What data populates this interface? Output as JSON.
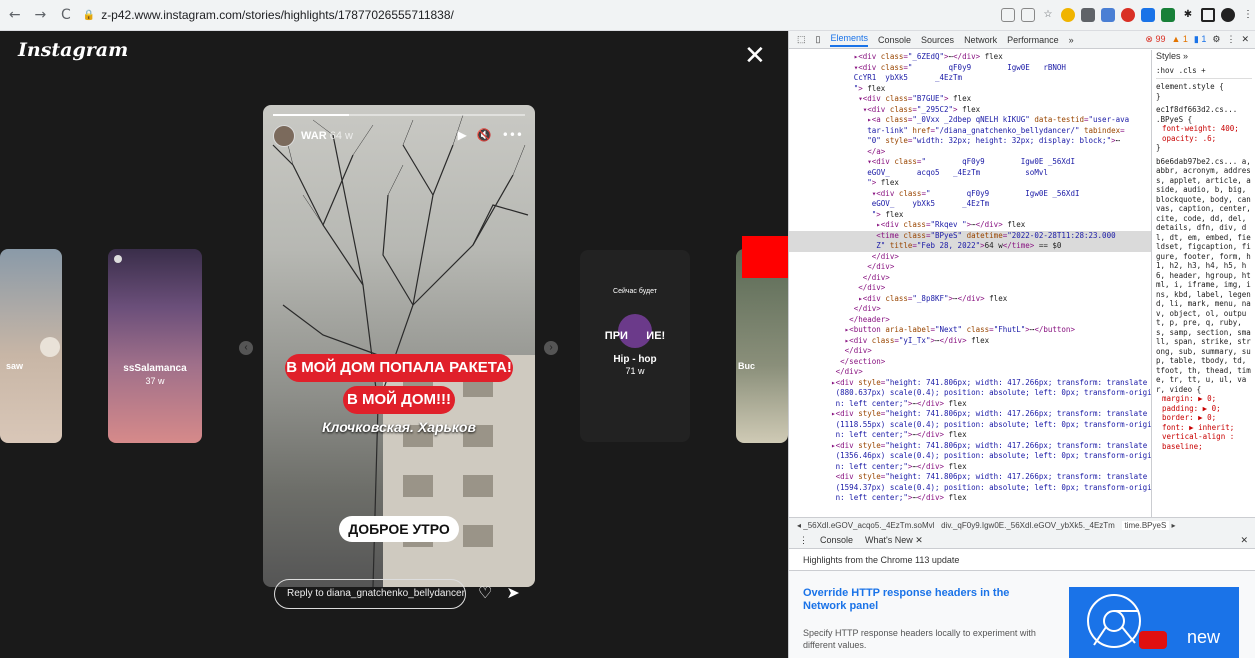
{
  "browser": {
    "url": "z-p42.www.instagram.com/stories/highlights/17877026555711838/",
    "back": "←",
    "forward": "→",
    "reload": "C"
  },
  "instagram": {
    "logo": "Instagram",
    "close": "✕",
    "cards": {
      "left": {
        "label": "saw"
      },
      "left2": {
        "user": "ssSalamanca",
        "time": "37 w"
      },
      "right": {
        "top_text": "Сейчас будет",
        "sticker": "ПРИ      ИЕ!",
        "title": "Hip - hop",
        "time": "71 w"
      },
      "far_right": {
        "label": "Buc"
      }
    },
    "story": {
      "user": "WAR",
      "time": "64 w",
      "sticker1": "В МОЙ ДОМ ПОПАЛА РАКЕТА!",
      "sticker2": "В МОЙ ДОМ!!!",
      "sticker3": "Клочковская. Харьков",
      "sticker4": "ДОБРОЕ УТРО",
      "reply_placeholder": "Reply to diana_gnatchenko_bellydancer..."
    }
  },
  "devtools": {
    "tabs": [
      "Elements",
      "Console",
      "Sources",
      "Network",
      "Performance",
      "»"
    ],
    "counts": {
      "errors": "99",
      "warnings": "1",
      "info": "1"
    },
    "styles_tab": "Styles",
    "styles_more": "»",
    "filter": ":hov  .cls  +",
    "element_style": "element.style {",
    "rule1_selector": "ec1f8df663d2.cs... .BPyeS {",
    "rule1_p1": "font-weight: 400;",
    "rule1_p2": "opacity: .6;",
    "rule2_selector": "b6e6dab97be2.cs... a, abbr, acronym, address, applet, article, aside, audio, b, big, blockquote, body, canvas, caption, center, cite, code, dd, del, details, dfn, div, dl, dt, em, embed, fieldset, figcaption, figure, footer, form, h1, h2, h3, h4, h5, h6, header, hgroup, html, i, iframe, img, ins, kbd, label, legend, li, mark, menu, nav, object, ol, output, p, pre, q, ruby, s, samp, section, small, span, strike, strong, sub, summary, sup, table, tbody, td, tfoot, th, thead, time, tr, tt, u, ul, var, video {",
    "rule2_props": [
      "margin: ▶ 0;",
      "padding: ▶ 0;",
      "border: ▶ 0;",
      "font: ▶ inherit;",
      "vertical-align : baseline;"
    ],
    "crumbs": [
      "◂",
      "_56XdI.eGOV_acqo5._4EzTm.soMvl",
      "div._qF0y9.Igw0E._56XdI.eGOV_ybXk5._4EzTm",
      "time.BPyeS",
      "▸"
    ],
    "drawer_tabs": [
      "Console",
      "What's New ✕"
    ],
    "drawer_close": "✕",
    "whatsnew_head": "Highlights from the Chrome 113 update",
    "wn_title": "Override HTTP response headers in the Network panel",
    "wn_desc": "Specify HTTP response headers locally to experiment with different values.",
    "wn_image_word": "new"
  }
}
